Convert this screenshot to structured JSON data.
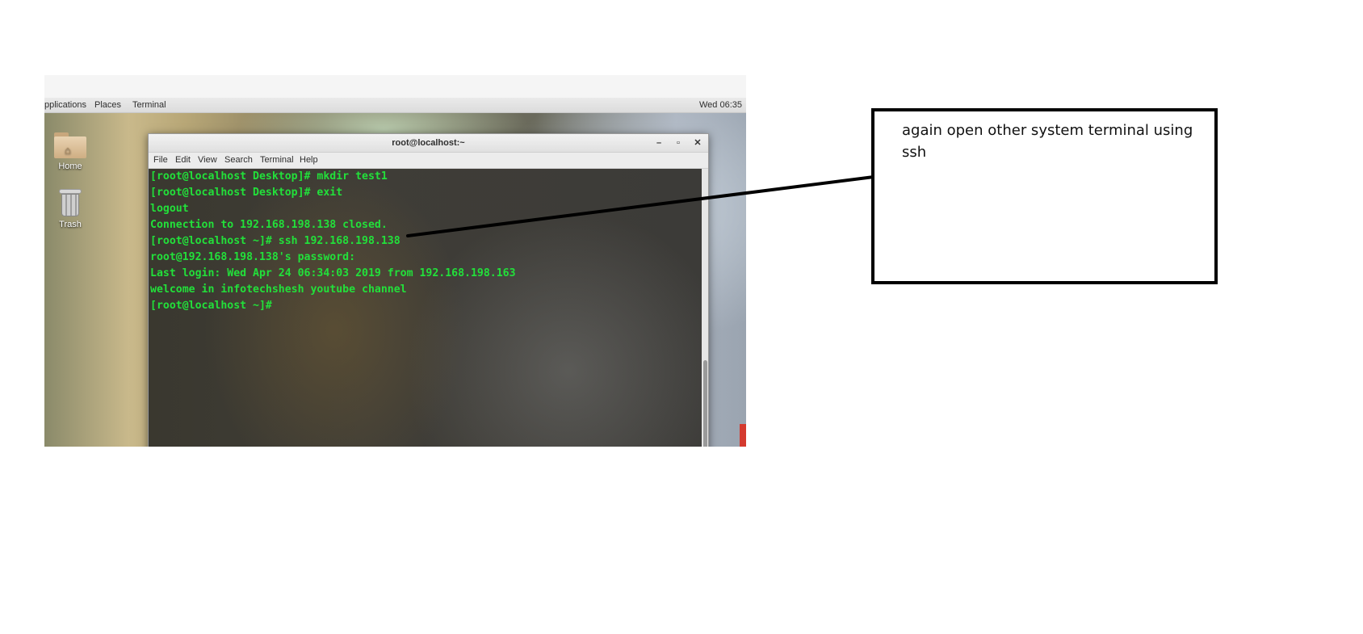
{
  "panel": {
    "menus": [
      "pplications",
      "Places",
      "Terminal"
    ],
    "clock": "Wed 06:35"
  },
  "desktop_icons": [
    {
      "label": "Home",
      "icon": "home-folder-icon"
    },
    {
      "label": "Trash",
      "icon": "trash-icon"
    }
  ],
  "terminal": {
    "title": "root@localhost:~",
    "menu": [
      "File",
      "Edit",
      "View",
      "Search",
      "Terminal",
      "Help"
    ],
    "lines": [
      "[root@localhost Desktop]# mkdir test1",
      "[root@localhost Desktop]# exit",
      "logout",
      "Connection to 192.168.198.138 closed.",
      "[root@localhost ~]# ssh 192.168.198.138",
      "root@192.168.198.138's password:",
      "Last login: Wed Apr 24 06:34:03 2019 from 192.168.198.163",
      "welcome in infotechshesh youtube channel",
      "[root@localhost ~]#"
    ],
    "text_color": "#22e03a"
  },
  "annotation": {
    "text": "again open other system terminal using ssh"
  }
}
